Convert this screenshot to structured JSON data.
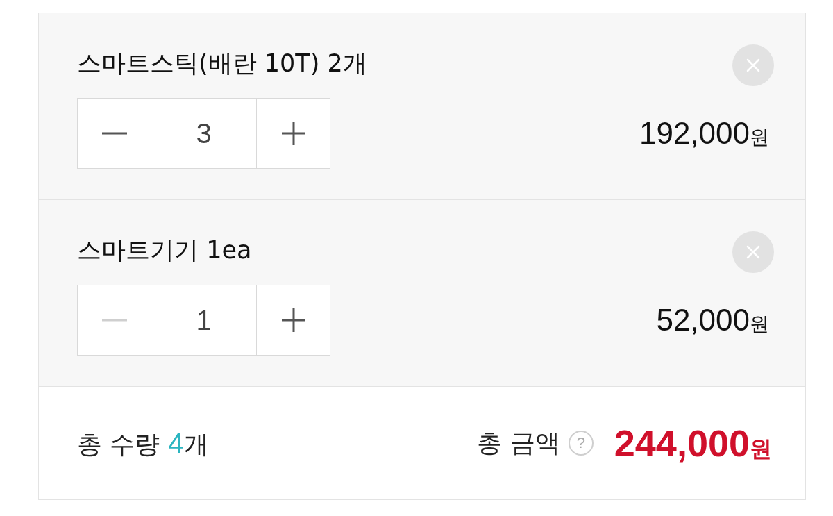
{
  "items": [
    {
      "name": "스마트스틱(배란 10T) 2개",
      "quantity": "3",
      "decrease_disabled": false,
      "price": "192,000",
      "currency": "원"
    },
    {
      "name": "스마트기기 1ea",
      "quantity": "1",
      "decrease_disabled": true,
      "price": "52,000",
      "currency": "원"
    }
  ],
  "summary": {
    "quantity_label": "총 수량",
    "quantity_count": "4",
    "quantity_unit": "개",
    "amount_label": "총 금액",
    "help": "?",
    "amount": "244,000",
    "currency": "원"
  }
}
